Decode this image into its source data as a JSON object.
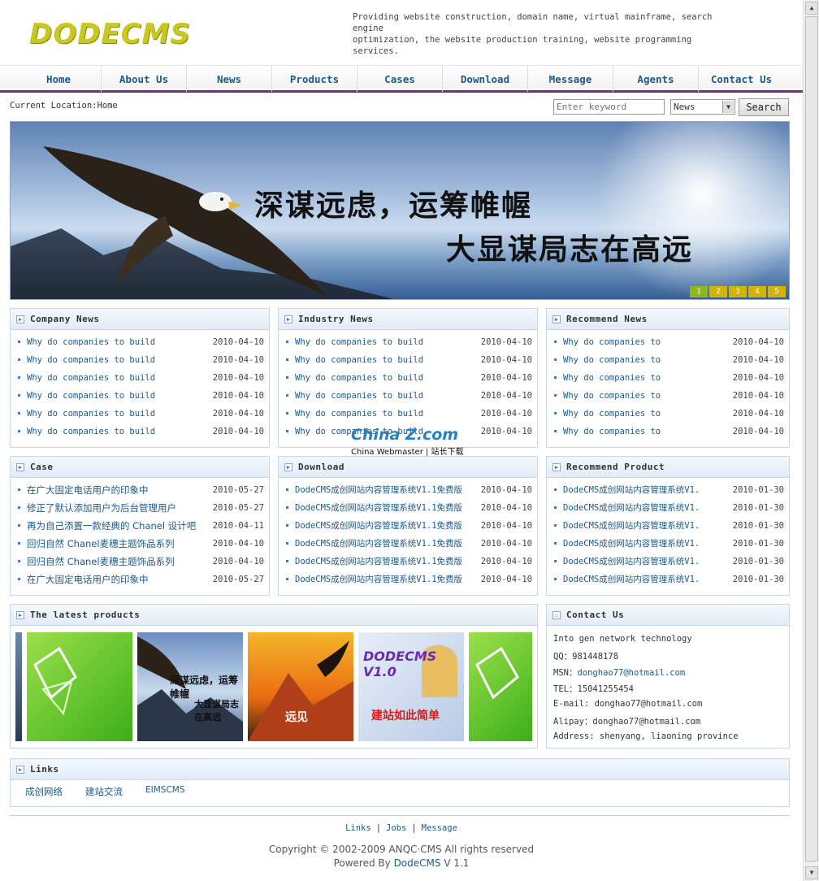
{
  "header": {
    "logo": "DODECMS",
    "tagline_line1": "Providing website construction, domain name, virtual mainframe, search engine",
    "tagline_line2": "optimization, the website production training, website programming services."
  },
  "nav": {
    "items": [
      "Home",
      "About Us",
      "News",
      "Products",
      "Cases",
      "Download",
      "Message",
      "Agents",
      "Contact Us"
    ]
  },
  "location": {
    "label": "Current Location:",
    "current": "Home"
  },
  "search": {
    "placeholder": "Enter keyword",
    "select_value": "News",
    "button": "Search"
  },
  "banner": {
    "line1": "深谋远虑，运筹帷幄",
    "line2": "大显谋局志在高远",
    "pages": [
      "1",
      "2",
      "3",
      "4",
      "5"
    ],
    "active_page": 1
  },
  "company_news": {
    "title": "Company News",
    "items": [
      {
        "text": "Why do companies to build",
        "date": "2010-04-10"
      },
      {
        "text": "Why do companies to build",
        "date": "2010-04-10"
      },
      {
        "text": "Why do companies to build",
        "date": "2010-04-10"
      },
      {
        "text": "Why do companies to build",
        "date": "2010-04-10"
      },
      {
        "text": "Why do companies to build",
        "date": "2010-04-10"
      },
      {
        "text": "Why do companies to build",
        "date": "2010-04-10"
      }
    ]
  },
  "industry_news": {
    "title": "Industry News",
    "items": [
      {
        "text": "Why do companies to build",
        "date": "2010-04-10"
      },
      {
        "text": "Why do companies to build",
        "date": "2010-04-10"
      },
      {
        "text": "Why do companies to build",
        "date": "2010-04-10"
      },
      {
        "text": "Why do companies to build",
        "date": "2010-04-10"
      },
      {
        "text": "Why do companies to build",
        "date": "2010-04-10"
      },
      {
        "text": "Why do companies to build",
        "date": "2010-04-10"
      }
    ]
  },
  "recommend_news": {
    "title": "Recommend News",
    "items": [
      {
        "text": "Why do companies to",
        "date": "2010-04-10"
      },
      {
        "text": "Why do companies to",
        "date": "2010-04-10"
      },
      {
        "text": "Why do companies to",
        "date": "2010-04-10"
      },
      {
        "text": "Why do companies to",
        "date": "2010-04-10"
      },
      {
        "text": "Why do companies to",
        "date": "2010-04-10"
      },
      {
        "text": "Why do companies to",
        "date": "2010-04-10"
      }
    ]
  },
  "case": {
    "title": "Case",
    "items": [
      {
        "text": "在广大固定电话用户的印象中",
        "date": "2010-05-27"
      },
      {
        "text": "修正了默认添加用户为后台管理用户",
        "date": "2010-05-27"
      },
      {
        "text": "再为自己添置一款经典的 Chanel 设计吧",
        "date": "2010-04-11"
      },
      {
        "text": "回归自然 Chanel麦穗主题饰品系列",
        "date": "2010-04-10"
      },
      {
        "text": "回归自然 Chanel麦穗主题饰品系列",
        "date": "2010-04-10"
      },
      {
        "text": "在广大固定电话用户的印象中",
        "date": "2010-05-27"
      }
    ]
  },
  "download": {
    "title": "Download",
    "items": [
      {
        "text": "DodeCMS成创网站内容管理系统V1.1免费版",
        "date": "2010-04-10"
      },
      {
        "text": "DodeCMS成创网站内容管理系统V1.1免费版",
        "date": "2010-04-10"
      },
      {
        "text": "DodeCMS成创网站内容管理系统V1.1免费版",
        "date": "2010-04-10"
      },
      {
        "text": "DodeCMS成创网站内容管理系统V1.1免费版",
        "date": "2010-04-10"
      },
      {
        "text": "DodeCMS成创网站内容管理系统V1.1免费版",
        "date": "2010-04-10"
      },
      {
        "text": "DodeCMS成创网站内容管理系统V1.1免费版",
        "date": "2010-04-10"
      }
    ]
  },
  "recommend_product": {
    "title": "Recommend Product",
    "items": [
      {
        "text": "DodeCMS成创网站内容管理系统V1.",
        "date": "2010-01-30"
      },
      {
        "text": "DodeCMS成创网站内容管理系统V1.",
        "date": "2010-01-30"
      },
      {
        "text": "DodeCMS成创网站内容管理系统V1.",
        "date": "2010-01-30"
      },
      {
        "text": "DodeCMS成创网站内容管理系统V1.",
        "date": "2010-01-30"
      },
      {
        "text": "DodeCMS成创网站内容管理系统V1.",
        "date": "2010-01-30"
      },
      {
        "text": "DodeCMS成创网站内容管理系统V1.",
        "date": "2010-01-30"
      }
    ]
  },
  "latest_products": {
    "title": "The latest products",
    "p2_line1": "深谋远虑，运筹帷幄",
    "p2_line2": "大显谋局志在高远",
    "p3_text": "远见",
    "p4_logo": "DODECMS V1.0",
    "p4_text": "建站如此简单"
  },
  "contact": {
    "title": "Contact Us",
    "company": "Into gen network technology",
    "qq": "QQ：981448178",
    "msn_label": "MSN：",
    "msn": "donghao77@hotmail.com",
    "tel": "TEL：15041255454",
    "email": "E-mail: donghao77@hotmail.com",
    "alipay": "Alipay：donghao77@hotmail.com",
    "address": "Address: shenyang, liaoning province"
  },
  "links": {
    "title": "Links",
    "items": [
      "成创网络",
      "建站交流",
      "EIMSCMS"
    ]
  },
  "footer": {
    "links": [
      "Links",
      "Jobs",
      "Message"
    ],
    "copyright": "Copyright © 2002-2009 ANQC·CMS All rights reserved",
    "powered_label": "Powered By ",
    "powered_brand": "DodeCMS",
    "powered_version": " V 1.1"
  },
  "watermark": {
    "line1": "China Z.com",
    "line2": "China Webmaster | 站长下载"
  },
  "colors": {
    "nav_text": "#1d5a86",
    "nav_underline": "#7b2b7b",
    "logo": "#c8c820",
    "link": "#1d5a86",
    "box_border": "#c8d6e6"
  }
}
